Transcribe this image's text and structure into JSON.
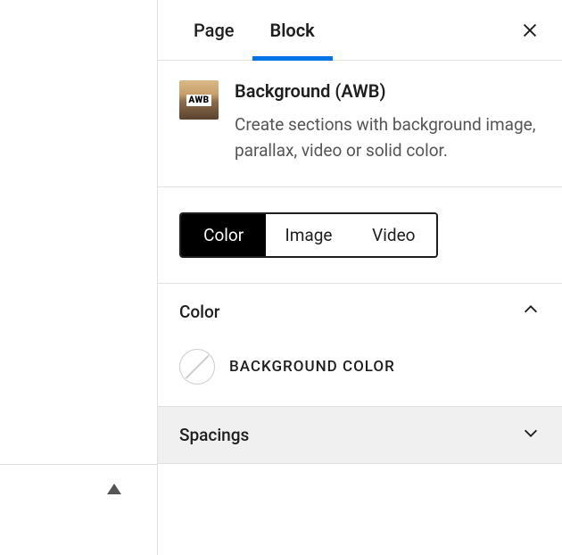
{
  "tabs": {
    "page": "Page",
    "block": "Block"
  },
  "block": {
    "icon_text": "AWB",
    "title": "Background (AWB)",
    "description": "Create sections with background image, parallax, video or solid color."
  },
  "type_selector": {
    "options": [
      "Color",
      "Image",
      "Video"
    ],
    "selected": "Color"
  },
  "panels": {
    "color": {
      "title": "Color",
      "field_label": "BACKGROUND COLOR"
    },
    "spacings": {
      "title": "Spacings"
    }
  }
}
